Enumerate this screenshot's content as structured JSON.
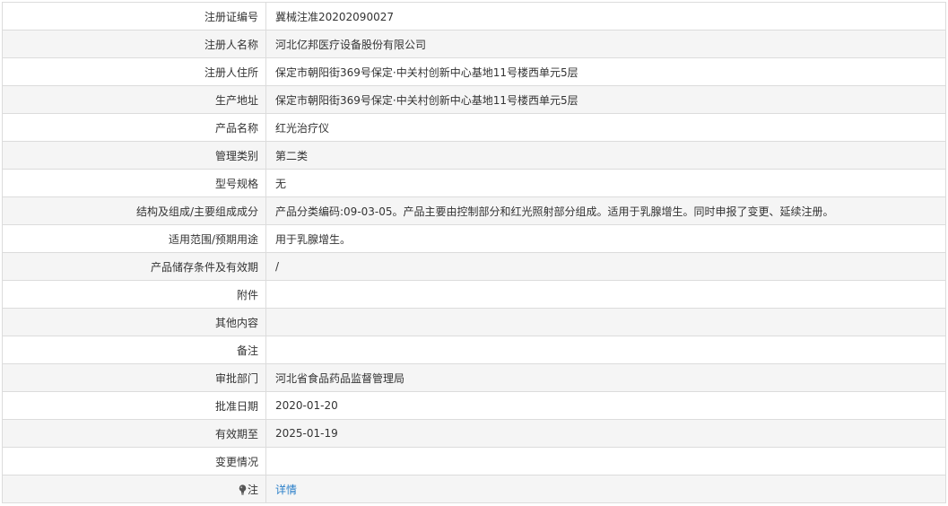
{
  "rows": [
    {
      "label": "注册证编号",
      "value": "冀械注准20202090027"
    },
    {
      "label": "注册人名称",
      "value": "河北亿邦医疗设备股份有限公司"
    },
    {
      "label": "注册人住所",
      "value": "保定市朝阳街369号保定·中关村创新中心基地11号楼西单元5层"
    },
    {
      "label": "生产地址",
      "value": "保定市朝阳街369号保定·中关村创新中心基地11号楼西单元5层"
    },
    {
      "label": "产品名称",
      "value": "红光治疗仪"
    },
    {
      "label": "管理类别",
      "value": "第二类"
    },
    {
      "label": "型号规格",
      "value": "无"
    },
    {
      "label": "结构及组成/主要组成成分",
      "value": "产品分类编码:09-03-05。产品主要由控制部分和红光照射部分组成。适用于乳腺增生。同时申报了变更、延续注册。"
    },
    {
      "label": "适用范围/预期用途",
      "value": "用于乳腺增生。"
    },
    {
      "label": "产品储存条件及有效期",
      "value": "/"
    },
    {
      "label": "附件",
      "value": ""
    },
    {
      "label": "其他内容",
      "value": ""
    },
    {
      "label": "备注",
      "value": ""
    },
    {
      "label": "审批部门",
      "value": "河北省食品药品监督管理局"
    },
    {
      "label": "批准日期",
      "value": "2020-01-20"
    },
    {
      "label": "有效期至",
      "value": "2025-01-19"
    },
    {
      "label": "变更情况",
      "value": ""
    }
  ],
  "note": {
    "icon": "lightbulb-icon",
    "label": "注",
    "link_text": "详情"
  },
  "colors": {
    "border": "#dcdcdc",
    "row_alt": "#f5f5f5",
    "text": "#333333",
    "link": "#2a7fc9"
  }
}
